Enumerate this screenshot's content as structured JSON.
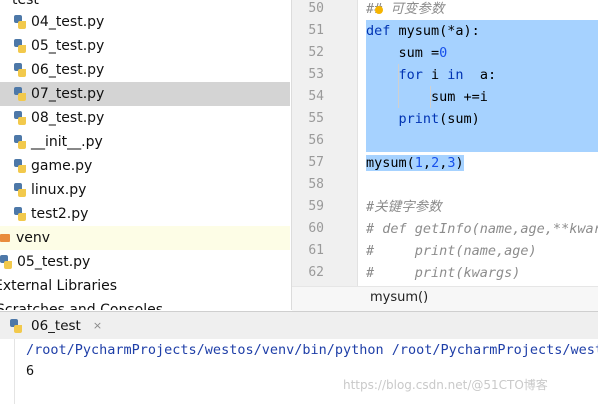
{
  "project_tree": {
    "items": [
      {
        "label": "test",
        "kind": "folder"
      },
      {
        "label": "04_test.py",
        "kind": "python-file"
      },
      {
        "label": "05_test.py",
        "kind": "python-file"
      },
      {
        "label": "06_test.py",
        "kind": "python-file"
      },
      {
        "label": "07_test.py",
        "kind": "python-file",
        "selected": true
      },
      {
        "label": "08_test.py",
        "kind": "python-file"
      },
      {
        "label": "__init__.py",
        "kind": "python-file"
      },
      {
        "label": "game.py",
        "kind": "python-file"
      },
      {
        "label": "linux.py",
        "kind": "python-file"
      },
      {
        "label": "test2.py",
        "kind": "python-file"
      },
      {
        "label": "venv",
        "kind": "folder"
      },
      {
        "label": "05_test.py",
        "kind": "python-file"
      },
      {
        "label": "External Libraries",
        "kind": "libraries"
      },
      {
        "label": "Scratches and Consoles",
        "kind": "scratches"
      }
    ]
  },
  "editor": {
    "line_numbers": [
      "50",
      "51",
      "52",
      "53",
      "54",
      "55",
      "56",
      "57",
      "58",
      "59",
      "60",
      "61",
      "62"
    ],
    "lines": [
      "## 可变参数",
      "def mysum(*a):",
      "    sum =0",
      "    for i in  a:",
      "        sum +=i",
      "    print(sum)",
      "",
      "mysum(1,2,3)",
      "",
      "#关键字参数",
      "# def getInfo(name,age,**kwargs):",
      "#     print(name,age)",
      "#     print(kwargs)"
    ],
    "breadcrumb": "mysum()"
  },
  "run_panel": {
    "tab_label": "06_test",
    "close_glyph": "×",
    "command": "/root/PycharmProjects/westos/venv/bin/python /root/PycharmProjects/westos/",
    "output": "6"
  },
  "watermark": "https://blog.csdn.net/@51CTO博客",
  "colors": {
    "selection": "#a6d2ff",
    "keyword": "#0033b3",
    "number": "#1750eb",
    "comment": "#8c8c8c",
    "current_line": "#fdfde6",
    "console_path": "#1f3fa8"
  }
}
